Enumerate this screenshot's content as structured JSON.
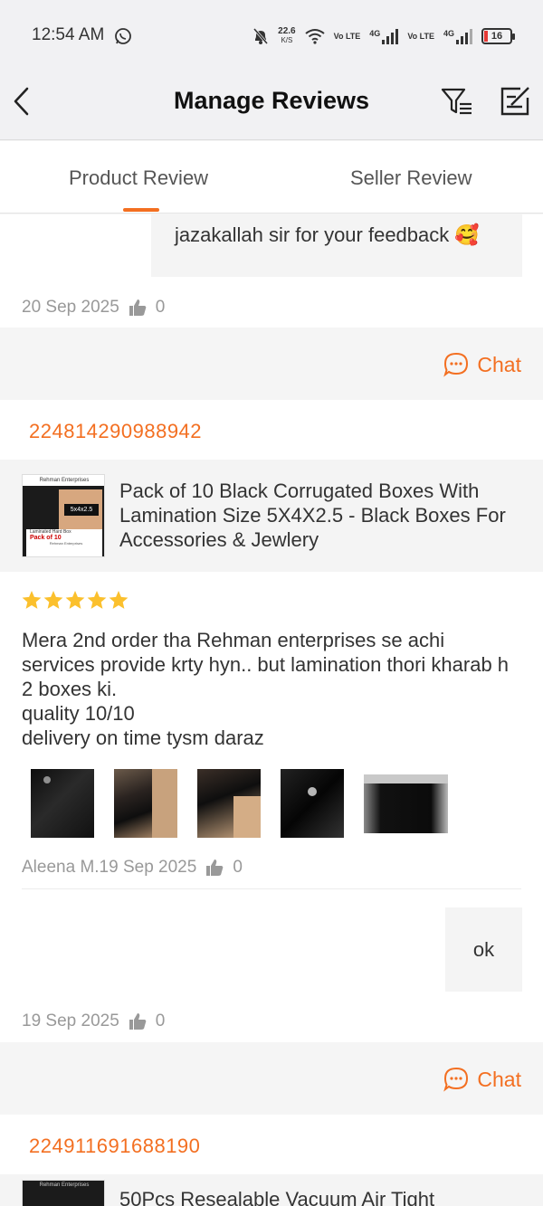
{
  "status_bar": {
    "time": "12:54 AM",
    "net_speed": "22.6",
    "net_unit": "K/S",
    "sim1_label": "Vo LTE",
    "sim1_net": "4G",
    "sim2_label": "Vo LTE",
    "sim2_net": "4G",
    "battery": "16"
  },
  "header": {
    "title": "Manage Reviews"
  },
  "tabs": [
    {
      "label": "Product Review",
      "active": true
    },
    {
      "label": "Seller Review",
      "active": false
    }
  ],
  "top_reply": {
    "text": "jazakallah sir for your feedback 🥰",
    "date": "20 Sep 2025",
    "likes": "0"
  },
  "chat_label": "Chat",
  "orders": [
    {
      "order_id": "224814290988942",
      "product_title": "Pack of 10 Black Corrugated Boxes With Lamination Size 5X4X2.5 - Black Boxes For Accessories & Jewlery",
      "product_img_brand": "Rehman Enterprises",
      "product_img_size": "5x4x2.5",
      "product_img_caption": "Laminated Hard Box",
      "product_img_pack": "Pack of 10",
      "product_img_footer": "Rehman Enterprises",
      "rating": 5,
      "review": "Mera 2nd order tha Rehman enterprises se achi services provide krty hyn.. but lamination thori kharab h 2 boxes ki.\nquality 10/10\ndelivery on time tysm daraz",
      "reviewer_date": "Aleena M.19 Sep 2025",
      "likes": "0",
      "reply": "ok",
      "reply_date": "19 Sep 2025",
      "reply_likes": "0"
    },
    {
      "order_id": "224911691688190",
      "product_title": "50Pcs Resealable Vacuum Air Tight",
      "product_img_brand": "Rehman Enterprises"
    }
  ]
}
